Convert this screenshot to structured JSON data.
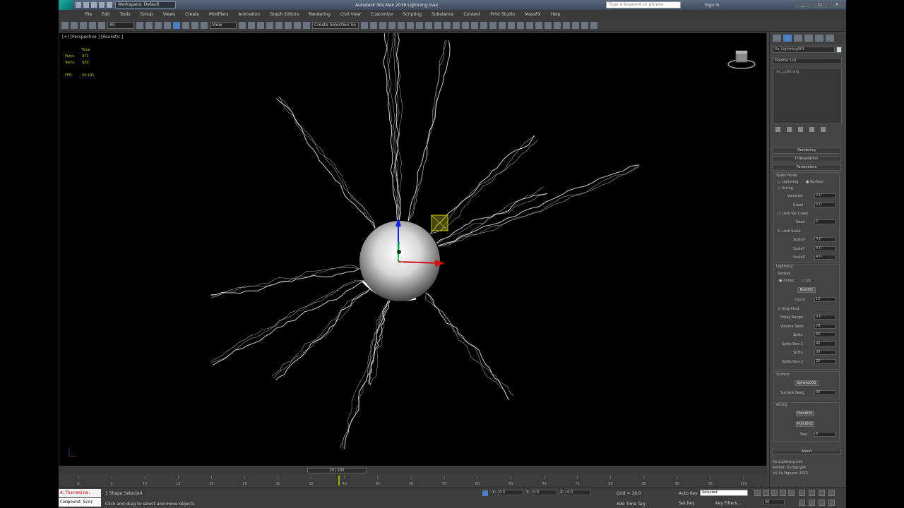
{
  "titlebar": {
    "workspace": "Workspace: Default",
    "title": "Autodesk 3ds Max 2016    Lightning.max",
    "search_placeholder": "Type a keyword or phrase",
    "signin": "Sign In"
  },
  "menu": [
    "File",
    "Edit",
    "Tools",
    "Group",
    "Views",
    "Create",
    "Modifiers",
    "Animation",
    "Graph Editors",
    "Rendering",
    "Civil View",
    "Customize",
    "Scripting",
    "Substance",
    "Content",
    "Print Studio",
    "MassFX",
    "Help"
  ],
  "toolbar": {
    "filter": "All",
    "ref_coord": "View",
    "named_sel": "Create Selection Se"
  },
  "viewport": {
    "label": "[+] [Perspective ] [Realistic ]",
    "stats": {
      "header": "Total",
      "polys_label": "Polys:",
      "polys_value": "971",
      "verts_label": "Verts:",
      "verts_value": "930",
      "fps_label": "FPS:",
      "fps_value": "43.191"
    }
  },
  "command_panel": {
    "object_name": "Xu_Lightning001",
    "modifier_list": "Modifier List",
    "stack_item": "Xu_Lightning",
    "rollouts": [
      "Rendering",
      "Interpolation",
      "Parameters"
    ],
    "params": {
      "spark_mode": "Spark Mode",
      "lightning": "Lightning",
      "surface": "Surface",
      "arcing": "Arcing",
      "variation": "Variation",
      "variation_val": "2.0",
      "crawl": "Crawl",
      "crawl_val": "0.0",
      "lock_var_crawl": "Lock Var Crawl",
      "seed": "Seed",
      "seed_val": "0",
      "lock_scale": "Lock Scale",
      "scale_x": "ScaleX",
      "scale_x_val": "4.0",
      "scale_y": "ScaleY",
      "scale_y_val": "4.0",
      "scale_z": "ScaleZ",
      "scale_z_val": "4.0",
      "lightning_header": "Lightning",
      "strokes": "Strokes",
      "zones": "Zones",
      "up": "Up",
      "box_btn": "Box001",
      "count": "Count",
      "count_val": "13",
      "stay_pivot": "Stay Pivot",
      "delay_range": "Delay Range",
      "delay_range_val": "0.0",
      "volume_seed": "Volume Seed",
      "volume_seed_val": "29",
      "splits": "Splits",
      "splits_val": "60",
      "splits_dev_1": "Splits Dev 1",
      "splits_dev_1_val": "40",
      "splits2": "Splits",
      "splits2_val": "30",
      "splits_dev_2": "Splits Dev 2",
      "splits_dev_2_val": "20",
      "surface_header": "Surface",
      "sphere_btn": "Sphere001",
      "surface_seed": "Surface Seed",
      "surface_seed_val": "30",
      "arcing_header": "Arcing",
      "point1_btn": "Point001",
      "point2_btn": "Point002",
      "seg": "Seg",
      "seg_val": "8"
    },
    "about": {
      "title": "About",
      "line1": "Xu Lightning Info",
      "line2": "Author: Xu Nguyen",
      "line3": "(c) Xu Nguyen 2015"
    }
  },
  "timeline": {
    "slider": "20 / 100",
    "ticks": [
      "0",
      "5",
      "10",
      "15",
      "20",
      "25",
      "30",
      "35",
      "40",
      "45",
      "50",
      "55",
      "60",
      "65",
      "70",
      "75",
      "80",
      "85",
      "90",
      "95",
      "100"
    ]
  },
  "status": {
    "maxscript1": "A:Theremine.",
    "maxscript2": "Compound Scor",
    "selection": "1 Shape Selected",
    "prompt": "Click and drag to select and move objects",
    "x_label": "X:",
    "x_val": "0.0",
    "y_label": "Y:",
    "y_val": "0.0",
    "z_label": "Z:",
    "z_val": "0.0",
    "grid": "Grid = 10.0",
    "autokey": "Auto Key",
    "selected": "Selected",
    "setkey": "Set Key",
    "keyfilters": "Key Filters...",
    "addtimetag": "Add Time Tag",
    "frame": "20"
  },
  "colors": {
    "accent": "#4d7fbf",
    "stats_text": "#c8c800",
    "gizmo_x": "#d01010",
    "gizmo_y": "#10d010",
    "gizmo_z": "#1020e0"
  }
}
